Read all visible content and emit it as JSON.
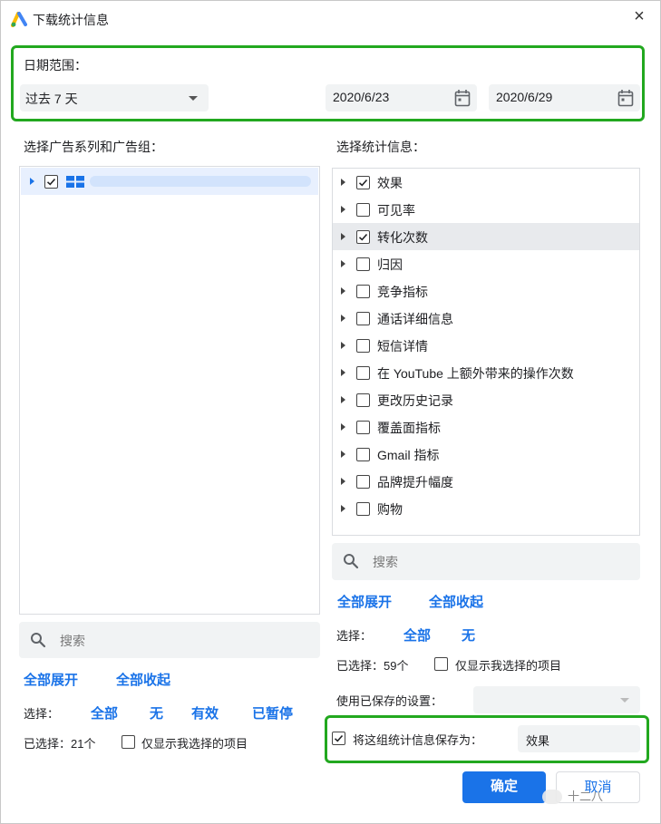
{
  "window": {
    "title": "下载统计信息",
    "close": "×"
  },
  "date_range": {
    "label": "日期范围：",
    "preset": "过去 7 天",
    "start": "2020/6/23",
    "end": "2020/6/29"
  },
  "campaigns": {
    "title": "选择广告系列和广告组：",
    "search_placeholder": "搜索",
    "expand_all": "全部展开",
    "collapse_all": "全部收起",
    "select_label": "选择：",
    "select_options": [
      "全部",
      "无",
      "有效",
      "已暂停"
    ],
    "selected_count": "已选择：21个",
    "only_show_selected": "仅显示我选择的项目"
  },
  "stats": {
    "title": "选择统计信息：",
    "items": [
      {
        "label": "效果",
        "checked": true
      },
      {
        "label": "可见率",
        "checked": false
      },
      {
        "label": "转化次数",
        "checked": true
      },
      {
        "label": "归因",
        "checked": false
      },
      {
        "label": "竞争指标",
        "checked": false
      },
      {
        "label": "通话详细信息",
        "checked": false
      },
      {
        "label": "短信详情",
        "checked": false
      },
      {
        "label": "在 YouTube 上额外带来的操作次数",
        "checked": false
      },
      {
        "label": "更改历史记录",
        "checked": false
      },
      {
        "label": "覆盖面指标",
        "checked": false
      },
      {
        "label": "Gmail 指标",
        "checked": false
      },
      {
        "label": "品牌提升幅度",
        "checked": false
      },
      {
        "label": "购物",
        "checked": false
      }
    ],
    "search_placeholder": "搜索",
    "expand_all": "全部展开",
    "collapse_all": "全部收起",
    "select_label": "选择：",
    "select_options": [
      "全部",
      "无"
    ],
    "selected_count": "已选择：59个",
    "only_show_selected": "仅显示我选择的项目",
    "use_saved_label": "使用已保存的设置：",
    "save_as_label": "将这组统计信息保存为：",
    "save_as_value": "效果"
  },
  "footer": {
    "confirm": "确定",
    "cancel": "取消",
    "watermark": "十二八"
  },
  "colors": {
    "accent": "#1a73e8",
    "highlight": "#22a81f"
  }
}
